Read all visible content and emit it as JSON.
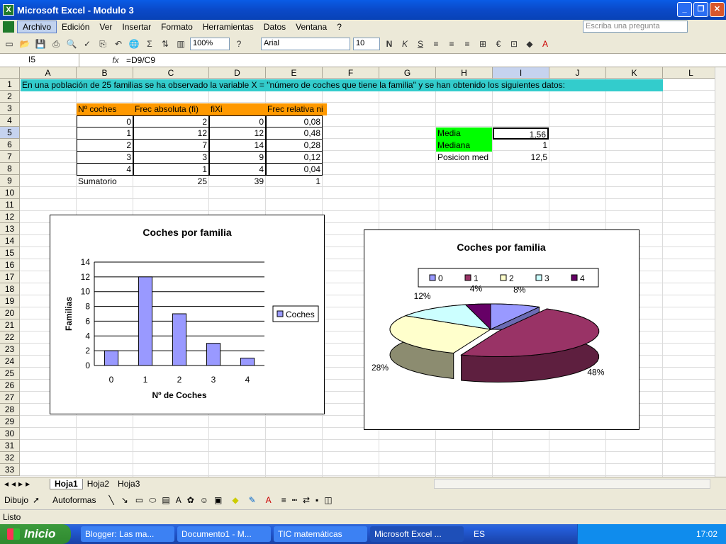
{
  "window": {
    "title": "Microsoft Excel - Modulo 3",
    "app_icon": "X"
  },
  "menu": {
    "items": [
      "Archivo",
      "Edición",
      "Ver",
      "Insertar",
      "Formato",
      "Herramientas",
      "Datos",
      "Ventana",
      "?"
    ],
    "ask_placeholder": "Escriba una pregunta"
  },
  "toolbar": {
    "zoom": "100%",
    "font": "Arial",
    "font_size": "10",
    "bold": "N",
    "italic": "K",
    "underline": "S"
  },
  "formula_bar": {
    "name_box": "I5",
    "fx": "fx",
    "formula": "=D9/C9"
  },
  "columns": [
    "A",
    "B",
    "C",
    "D",
    "E",
    "F",
    "G",
    "H",
    "I",
    "J",
    "K",
    "L"
  ],
  "rows": [
    "1",
    "2",
    "3",
    "4",
    "5",
    "6",
    "7",
    "8",
    "9",
    "10",
    "11",
    "12",
    "13",
    "14",
    "15",
    "16",
    "17",
    "18",
    "19",
    "20",
    "21",
    "22",
    "23",
    "24",
    "25",
    "26",
    "27",
    "28",
    "29",
    "30",
    "31",
    "32",
    "33"
  ],
  "sheet": {
    "intro_text": "En una población de 25 familias se ha observado la variable X = \"número de coches que tiene la familia\" y se han obtenido los siguientes datos:",
    "table_headers": [
      "Nº coches",
      "Frec absoluta (fi)",
      "fiXi",
      "Frec relativa ni"
    ],
    "table_rows": [
      [
        "0",
        "2",
        "0",
        "0,08"
      ],
      [
        "1",
        "12",
        "12",
        "0,48"
      ],
      [
        "2",
        "7",
        "14",
        "0,28"
      ],
      [
        "3",
        "3",
        "9",
        "0,12"
      ],
      [
        "4",
        "1",
        "4",
        "0,04"
      ]
    ],
    "sum_row": [
      "Sumatorio",
      "25",
      "39",
      "1"
    ],
    "stats": [
      {
        "label": "Media",
        "value": "1,56"
      },
      {
        "label": "Mediana",
        "value": "1"
      },
      {
        "label": "Posicion med",
        "value": "12,5"
      }
    ]
  },
  "chart_data": [
    {
      "type": "bar",
      "title": "Coches por familia",
      "xlabel": "Nº de Coches",
      "ylabel": "Familias",
      "categories": [
        "0",
        "1",
        "2",
        "3",
        "4"
      ],
      "series": [
        {
          "name": "Coches",
          "values": [
            2,
            12,
            7,
            3,
            1
          ]
        }
      ],
      "ylim": [
        0,
        14
      ],
      "yticks": [
        "0",
        "2",
        "4",
        "6",
        "8",
        "10",
        "12",
        "14"
      ],
      "legend": "right",
      "color": "#9999ff"
    },
    {
      "type": "pie",
      "title": "Coches por familia",
      "labels": [
        "0",
        "1",
        "2",
        "3",
        "4"
      ],
      "values": [
        8,
        48,
        28,
        12,
        4
      ],
      "data_labels": [
        "8%",
        "48%",
        "28%",
        "12%",
        "4%"
      ],
      "colors": [
        "#9999ff",
        "#993366",
        "#ffffcc",
        "#ccffff",
        "#660066"
      ],
      "legend": "top"
    }
  ],
  "sheet_tabs": [
    "Hoja1",
    "Hoja2",
    "Hoja3"
  ],
  "drawing_toolbar": {
    "draw": "Dibujo",
    "autoshapes": "Autoformas"
  },
  "status": "Listo",
  "taskbar": {
    "start": "Inicio",
    "tasks": [
      "Blogger: Las ma...",
      "Documento1 - M...",
      "TIC matemáticas",
      "Microsoft Excel ..."
    ],
    "lang": "ES",
    "clock": "17:02"
  }
}
